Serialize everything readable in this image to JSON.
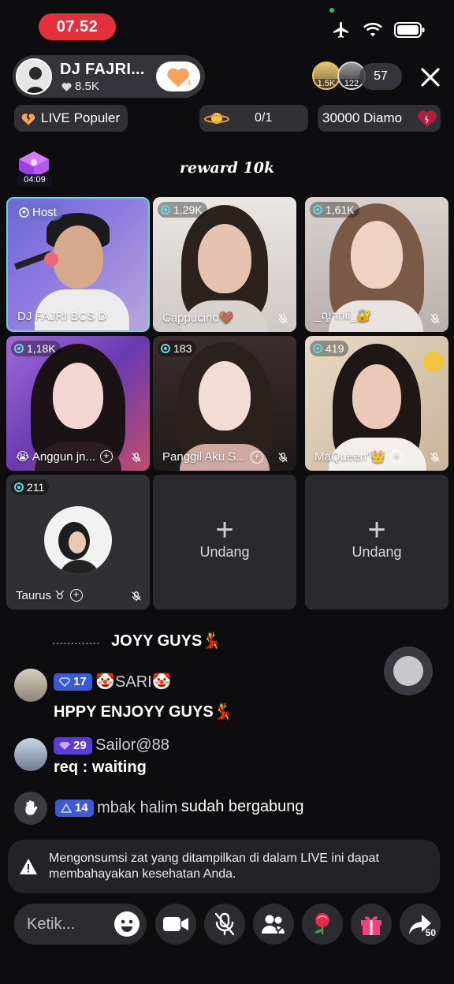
{
  "status": {
    "time": "07.52"
  },
  "host": {
    "name": "DJ FAJRI...",
    "likes": "8.5K",
    "follow_count": "4"
  },
  "viewers": {
    "avatar1_label": "1.5K",
    "avatar2_label": "122",
    "count": "57"
  },
  "chips": {
    "popular": "LIVE Populer",
    "rank": "0/1",
    "diamond": "30000 Diamo"
  },
  "reward": {
    "timer": "04:09",
    "title": "reward 10k"
  },
  "grid": {
    "host_tag": "Host",
    "tiles": [
      {
        "name": "DJ FAJRI BCS D",
        "views": "",
        "host": true
      },
      {
        "name": "Cappucino🤎",
        "views": "1,29K"
      },
      {
        "name": "_ญากii_🔐",
        "views": "1,61K"
      },
      {
        "name": "😭 Anggun jn...",
        "views": "1,18K"
      },
      {
        "name": "Panggil Aku S...",
        "views": "183"
      },
      {
        "name": "MaQueen\"👑",
        "views": "419"
      },
      {
        "name": "Taurus ♉",
        "views": "211"
      }
    ],
    "invite_label": "Undang"
  },
  "chat": [
    {
      "user": "",
      "level": "",
      "message": "JOYY GUYS💃",
      "prefix": "·············"
    },
    {
      "user": "🤡SARI🤡",
      "level": "17",
      "message": "HPPY ENJOYY GUYS💃"
    },
    {
      "user": "Sailor@88",
      "level": "29",
      "message": "req : waiting"
    },
    {
      "user": "mbak halim",
      "level": "14",
      "message": "sudah bergabung"
    }
  ],
  "warning": {
    "text": "Mengonsumsi zat yang ditampilkan di dalam LIVE ini dapat membahayakan kesehatan Anda."
  },
  "bottom": {
    "input_placeholder": "Ketik...",
    "share_count": "50"
  },
  "colors": {
    "accent": "#e5303c",
    "teal": "#5fd9e0",
    "badge_blue": "#3b5bd6",
    "badge_purple": "#5b3bd6"
  }
}
